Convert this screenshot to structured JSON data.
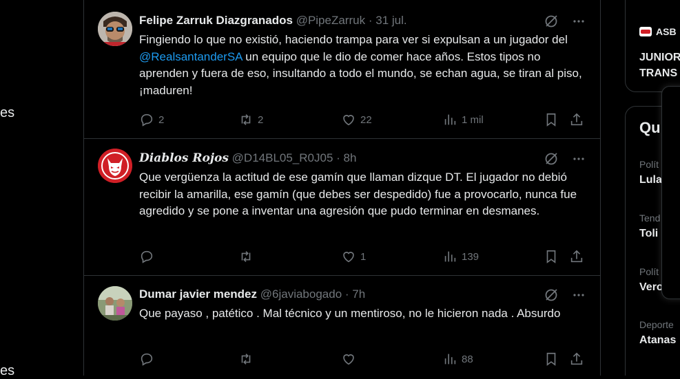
{
  "left_nav": {
    "frag1": "es",
    "frag2": "es"
  },
  "tweets": [
    {
      "name": "Felipe Zarruk Diazgranados",
      "handle": "@PipeZarruk",
      "dot": "·",
      "time": "31 jul.",
      "text_before": "Fingiendo lo que no existió, haciendo trampa para ver si expulsan a un jugador del ",
      "mention": "@RealsantanderSA",
      "text_after": " un equipo que le dio de comer hace años. Estos tipos no aprenden y fuera de eso, insultando a todo el mundo, se echan agua, se tiran al piso, ¡maduren!",
      "replies": "2",
      "retweets": "2",
      "likes": "22",
      "views": "1 mil"
    },
    {
      "name": "Diablos Rojos",
      "handle": "@D14BL05_R0J05",
      "dot": "·",
      "time": "8h",
      "text": "Que vergüenza la actitud de ese gamín que llaman dizque DT. El jugador no debió recibir la amarilla, ese gamín (que debes ser despedido) fue a provocarlo, nunca fue agredido y se pone a inventar una agresión que pudo terminar en desmanes.",
      "replies": "",
      "retweets": "",
      "likes": "1",
      "views": "139"
    },
    {
      "name": "Dumar javier mendez",
      "handle": "@6javiabogado",
      "dot": "·",
      "time": "7h",
      "text": "Que payaso , patético . Mal técnico y un mentiroso, no le hicieron nada . Absurdo",
      "replies": "",
      "retweets": "",
      "likes": "",
      "views": "88"
    }
  ],
  "right": {
    "trend_card": {
      "source": "ASB",
      "line1": "JUNIOR",
      "line2": "TRANS"
    },
    "whats_happening": {
      "title": "Qu",
      "items": [
        {
          "category": "Polít",
          "name": "Lula"
        },
        {
          "category": "Tend",
          "name": "Toli"
        },
        {
          "category": "Polít",
          "name": "Vero"
        },
        {
          "category": "Deporte",
          "name": "Atanas"
        }
      ]
    }
  },
  "colors": {
    "accent": "#1d9bf0",
    "text": "#e7e9ea",
    "muted": "#71767b",
    "border": "#2f3336",
    "diablos_red": "#d01f26"
  }
}
